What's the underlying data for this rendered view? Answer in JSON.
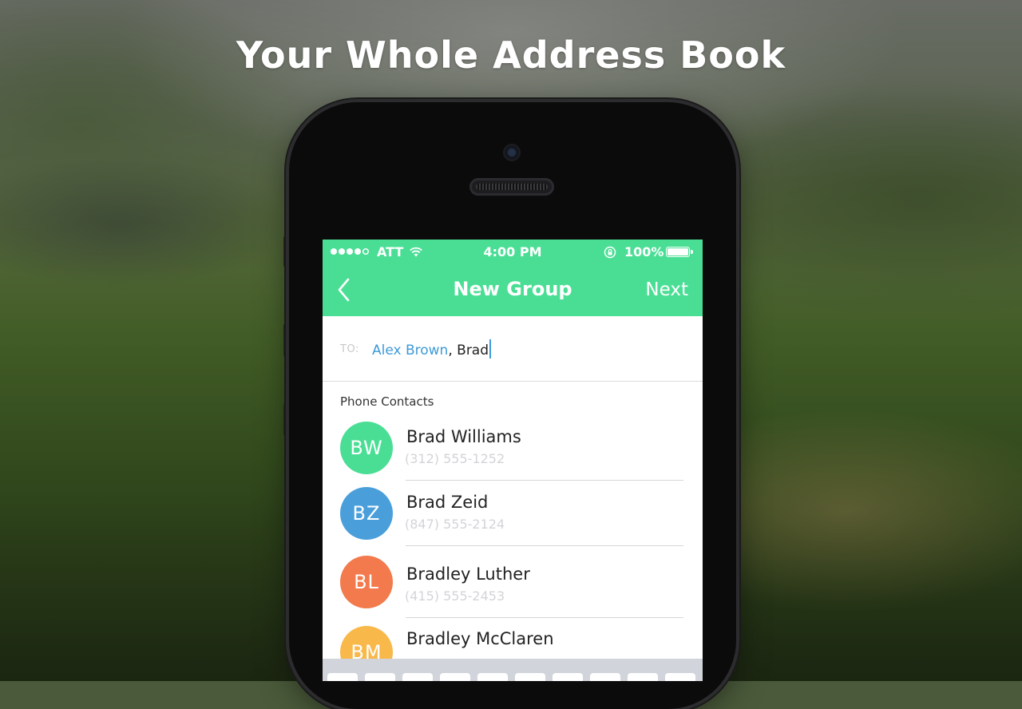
{
  "headline": "Your Whole Address Book",
  "status_bar": {
    "carrier": "ATT",
    "time": "4:00 PM",
    "battery": "100%"
  },
  "nav": {
    "title": "New Group",
    "next_label": "Next"
  },
  "recipients": {
    "to_label": "TO:",
    "selected": "Alex Brown",
    "separator": ",",
    "typed": "Brad"
  },
  "contacts_section": {
    "header": "Phone Contacts",
    "items": [
      {
        "initials": "BW",
        "name": "Brad Williams",
        "phone": "(312) 555-1252",
        "color": "#4ade95"
      },
      {
        "initials": "BZ",
        "name": "Brad Zeid",
        "phone": "(847) 555-2124",
        "color": "#4a9fdb"
      },
      {
        "initials": "BL",
        "name": "Bradley Luther",
        "phone": "(415) 555-2453",
        "color": "#f27a4c"
      },
      {
        "initials": "BM",
        "name": "Bradley McClaren",
        "phone": "",
        "color": "#f9b84a"
      }
    ]
  },
  "colors": {
    "accent": "#4ade95",
    "link": "#3d9ad8"
  }
}
